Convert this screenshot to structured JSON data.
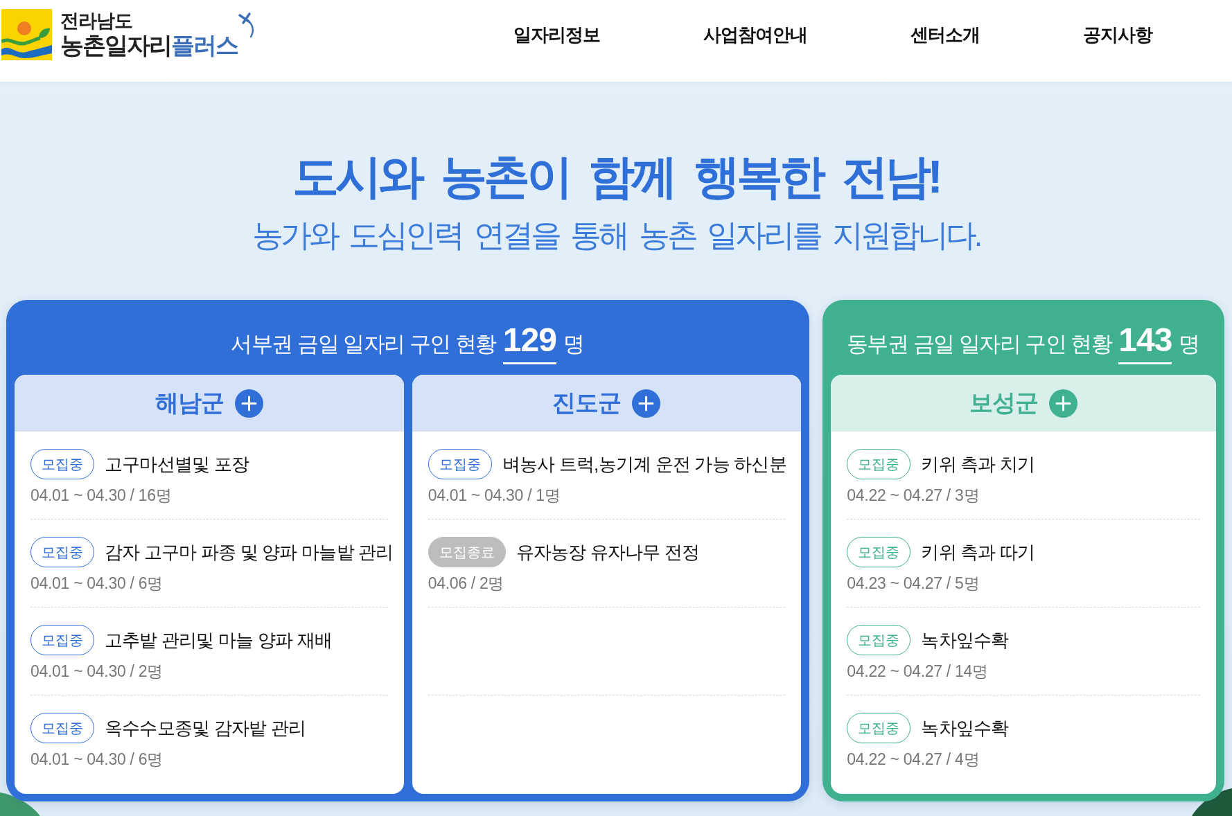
{
  "header": {
    "logo": {
      "region": "전라남도",
      "title": "농촌일자리",
      "title_accent": "플러스"
    },
    "nav": [
      {
        "label": "일자리정보"
      },
      {
        "label": "사업참여안내"
      },
      {
        "label": "센터소개"
      },
      {
        "label": "공지사항"
      }
    ]
  },
  "hero": {
    "title": "도시와 농촌이 함께 행복한 전남!",
    "subtitle": "농가와 도심인력 연결을 통해 농촌 일자리를 지원합니다."
  },
  "regions": [
    {
      "title": "서부권 금일 일자리 구인 현황",
      "count": "129",
      "unit": "명",
      "color": "#306fd8",
      "counties": [
        {
          "name": "해남군",
          "jobs": [
            {
              "status": "모집중",
              "recruiting": true,
              "title": "고구마선별및 포장",
              "period": "04.01 ~ 04.30 / 16명"
            },
            {
              "status": "모집중",
              "recruiting": true,
              "title": "감자 고구마 파종 및 양파 마늘밭 관리",
              "period": "04.01 ~ 04.30 / 6명"
            },
            {
              "status": "모집중",
              "recruiting": true,
              "title": "고추밭 관리및 마늘 양파 재배",
              "period": "04.01 ~ 04.30 / 2명"
            },
            {
              "status": "모집중",
              "recruiting": true,
              "title": "옥수수모종및 감자밭 관리",
              "period": "04.01 ~ 04.30 / 6명"
            }
          ]
        },
        {
          "name": "진도군",
          "jobs": [
            {
              "status": "모집중",
              "recruiting": true,
              "title": "벼농사 트럭,농기계 운전 가능 하신분",
              "period": "04.01 ~ 04.30 / 1명"
            },
            {
              "status": "모집종료",
              "recruiting": false,
              "title": "유자농장 유자나무 전정",
              "period": "04.06 / 2명"
            }
          ]
        }
      ]
    },
    {
      "title": "동부권 금일 일자리 구인 현황",
      "count": "143",
      "unit": "명",
      "color": "#3fb18f",
      "counties": [
        {
          "name": "보성군",
          "jobs": [
            {
              "status": "모집중",
              "recruiting": true,
              "title": "키위 측과 치기",
              "period": "04.22 ~ 04.27 / 3명"
            },
            {
              "status": "모집중",
              "recruiting": true,
              "title": "키위 측과 따기",
              "period": "04.23 ~ 04.27 / 5명"
            },
            {
              "status": "모집중",
              "recruiting": true,
              "title": "녹차잎수확",
              "period": "04.22 ~ 04.27 / 14명"
            },
            {
              "status": "모집중",
              "recruiting": true,
              "title": "녹차잎수확",
              "period": "04.22 ~ 04.27 / 4명"
            }
          ]
        }
      ]
    }
  ]
}
